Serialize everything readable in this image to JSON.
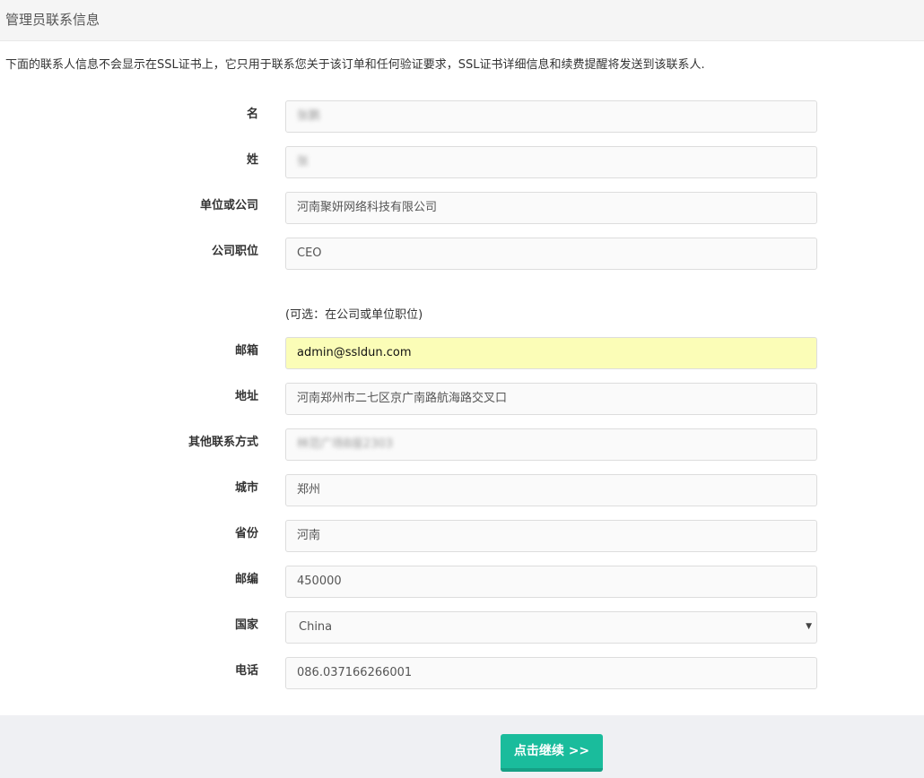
{
  "panel": {
    "title": "管理员联系信息",
    "notice": "下面的联系人信息不会显示在SSL证书上，它只用于联系您关于该订单和任何验证要求，SSL证书详细信息和续费提醒将发送到该联系人."
  },
  "form": {
    "first_name": {
      "label": "名",
      "value": "张鹏"
    },
    "last_name": {
      "label": "姓",
      "value": "张"
    },
    "organization": {
      "label": "单位或公司",
      "value": "河南聚妍网络科技有限公司"
    },
    "job_title": {
      "label": "公司职位",
      "value": "CEO",
      "hint": "(可选：在公司或单位职位)"
    },
    "email": {
      "label": "邮箱",
      "value": "admin@ssldun.com"
    },
    "address": {
      "label": "地址",
      "value": "河南郑州市二七区京广南路航海路交叉口"
    },
    "other_contact": {
      "label": "其他联系方式",
      "value": "林范广场B座2303"
    },
    "city": {
      "label": "城市",
      "value": "郑州"
    },
    "province": {
      "label": "省份",
      "value": "河南"
    },
    "postcode": {
      "label": "邮编",
      "value": "450000"
    },
    "country": {
      "label": "国家",
      "value": "China"
    },
    "phone": {
      "label": "电话",
      "value": "086.037166266001"
    }
  },
  "footer": {
    "continue_label": "点击继续 >>"
  },
  "colors": {
    "accent": "#1abc9c",
    "autofill": "#fbfdb7"
  }
}
